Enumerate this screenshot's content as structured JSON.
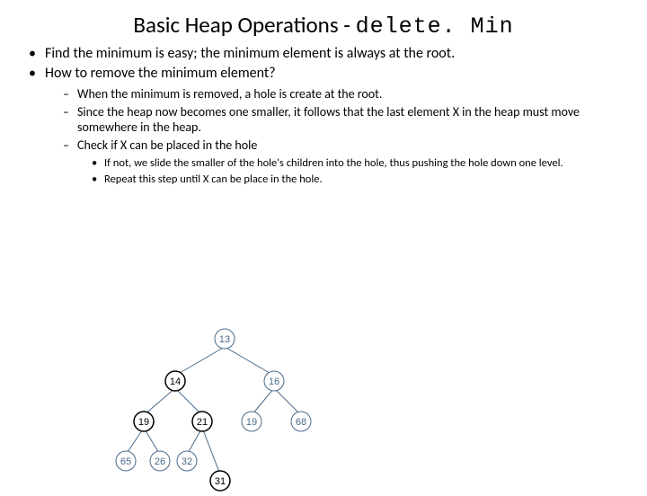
{
  "title_prefix": "Basic Heap Operations - ",
  "title_mono": "delete. Min",
  "bullets_l1": {
    "a": "Find the minimum is easy; the minimum element is always at the root.",
    "b": "How to remove the minimum element?"
  },
  "bullets_l2": {
    "a": "When the minimum is removed, a hole is create at the root.",
    "b": "Since the heap now becomes one smaller, it follows that the last element  X in the heap must move somewhere in the heap.",
    "c": "Check if X can be placed in the hole"
  },
  "bullets_l3": {
    "a": "If not, we slide the smaller of the hole's children into the hole, thus pushing the hole down one level.",
    "b": "Repeat this step until X can be place in the hole."
  },
  "chart_data": {
    "type": "tree",
    "title": "",
    "root": 13,
    "nodes": [
      {
        "id": 13,
        "children": [
          14,
          16
        ]
      },
      {
        "id": 14,
        "children": [
          19,
          21
        ],
        "highlight": true
      },
      {
        "id": 16,
        "children": [
          19,
          68
        ]
      },
      {
        "id": 19,
        "children": [
          65,
          26
        ],
        "highlight": true
      },
      {
        "id": 21,
        "children": [
          32,
          31
        ],
        "highlight": true
      },
      {
        "id": 19,
        "children": []
      },
      {
        "id": 68,
        "children": []
      },
      {
        "id": 65,
        "children": []
      },
      {
        "id": 26,
        "children": []
      },
      {
        "id": 32,
        "children": []
      },
      {
        "id": 31,
        "children": [],
        "highlight": true
      }
    ],
    "labels": {
      "n13": "13",
      "n14": "14",
      "n16": "16",
      "n19a": "19",
      "n21": "21",
      "n19b": "19",
      "n68": "68",
      "n65": "65",
      "n26": "26",
      "n32": "32",
      "n31": "31"
    }
  }
}
